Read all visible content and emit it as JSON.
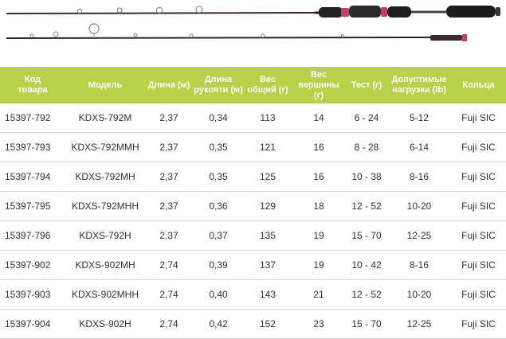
{
  "colors": {
    "header_bg": "#b9d14a",
    "header_text": "#ffffff",
    "accent": "#c04060",
    "row_border": "#d9d9d9"
  },
  "image": {
    "description_icon": "fishing-rod-icon"
  },
  "table": {
    "headers": [
      "Код\nтовара",
      "Модель",
      "Длина (м)",
      "Длина\nрукояти (м)",
      "Вес\nобщий (г)",
      "Вес\nвершины (г)",
      "Тест (г)",
      "Допустимые\nнагрузки (lb)",
      "Кольца"
    ],
    "rows": [
      [
        "15397-792",
        "KDXS-792M",
        "2,37",
        "0,34",
        "113",
        "14",
        "6 - 24",
        "5-12",
        "Fuji SIC"
      ],
      [
        "15397-793",
        "KDXS-792MMH",
        "2,37",
        "0,35",
        "121",
        "16",
        "8 - 28",
        "6-14",
        "Fuji SIC"
      ],
      [
        "15397-794",
        "KDXS-792MH",
        "2,37",
        "0,35",
        "125",
        "16",
        "10 - 38",
        "8-16",
        "Fuji SIC"
      ],
      [
        "15397-795",
        "KDXS-792MHH",
        "2,37",
        "0,36",
        "129",
        "18",
        "12 - 52",
        "10-20",
        "Fuji SIC"
      ],
      [
        "15397-796",
        "KDXS-792H",
        "2,37",
        "0,37",
        "135",
        "19",
        "15 - 70",
        "12-25",
        "Fuji SIC"
      ],
      [
        "15397-902",
        "KDXS-902MH",
        "2,74",
        "0,39",
        "137",
        "19",
        "10 - 42",
        "8-16",
        "Fuji SIC"
      ],
      [
        "15397-903",
        "KDXS-902MHH",
        "2,74",
        "0,40",
        "143",
        "21",
        "12 - 52",
        "10-20",
        "Fuji SIC"
      ],
      [
        "15397-904",
        "KDXS-902H",
        "2,74",
        "0,42",
        "152",
        "23",
        "15 - 70",
        "12-25",
        "Fuji SIC"
      ]
    ]
  }
}
